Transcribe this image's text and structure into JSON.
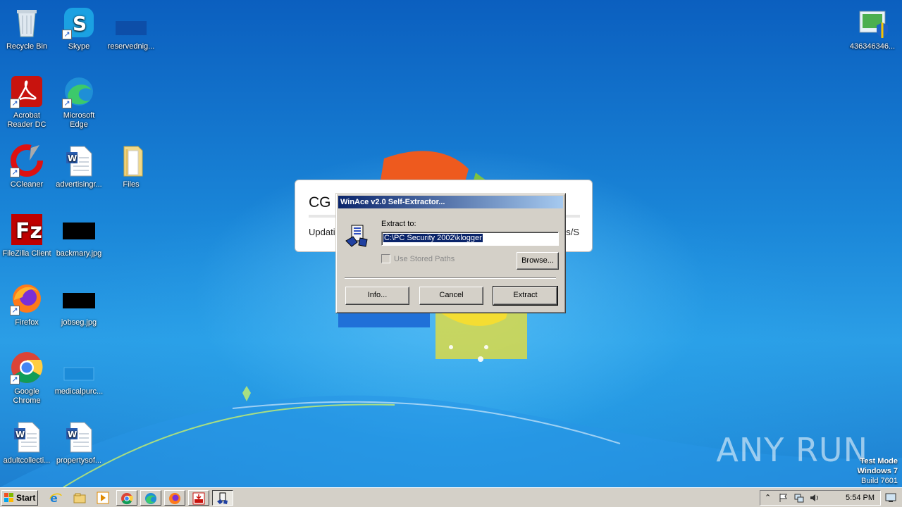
{
  "desktop": {
    "icons": [
      {
        "label": "Recycle Bin",
        "icon": "recycle-bin-icon"
      },
      {
        "label": "Skype",
        "icon": "skype-icon"
      },
      {
        "label": "reservednig...",
        "icon": "file-icon"
      },
      {
        "label": "Acrobat Reader DC",
        "icon": "acrobat-icon"
      },
      {
        "label": "Microsoft Edge",
        "icon": "edge-icon"
      },
      {
        "label": "CCleaner",
        "icon": "ccleaner-icon"
      },
      {
        "label": "advertisingr...",
        "icon": "word-doc-icon"
      },
      {
        "label": "Files",
        "icon": "folder-icon"
      },
      {
        "label": "FileZilla Client",
        "icon": "filezilla-icon"
      },
      {
        "label": "backmary.jpg",
        "icon": "image-file-icon"
      },
      {
        "label": "Firefox",
        "icon": "firefox-icon"
      },
      {
        "label": "jobseg.jpg",
        "icon": "image-file-icon"
      },
      {
        "label": "Google Chrome",
        "icon": "chrome-icon"
      },
      {
        "label": "medicalpurc...",
        "icon": "file-icon"
      },
      {
        "label": "adultcollecti...",
        "icon": "word-doc-icon"
      },
      {
        "label": "propertysof...",
        "icon": "word-doc-icon"
      },
      {
        "label": "436346346...",
        "icon": "installer-icon"
      }
    ]
  },
  "background_window": {
    "title": "CG U",
    "status": "Updatin",
    "status_right": "s/S"
  },
  "dialog": {
    "title": "WinAce v2.0 Self-Extractor...",
    "extract_label": "Extract to:",
    "extract_path": "C:\\PC Security 2002\\klogger",
    "stored_paths_label": "Use Stored Paths",
    "stored_paths_checked": false,
    "browse_label": "Browse...",
    "info_label": "Info...",
    "cancel_label": "Cancel",
    "extract_button_label": "Extract"
  },
  "watermark": {
    "brand": "ANY RUN",
    "mode": "Test Mode",
    "os": "Windows 7",
    "build": "Build 7601"
  },
  "taskbar": {
    "start_label": "Start",
    "clock": "5:54 PM",
    "quick_launch": [
      "ie-icon",
      "explorer-icon",
      "media-player-icon",
      "chrome-icon",
      "edge-icon",
      "firefox-icon",
      "acrobat-icon",
      "winace-icon"
    ],
    "tray_icons": [
      "show-hidden-icon",
      "flag-icon",
      "network-icon",
      "volume-icon"
    ]
  },
  "colors": {
    "desktop_blue": "#1580d4",
    "dialog_face": "#d4d0c8",
    "title_gradient_start": "#0a246a",
    "title_gradient_end": "#a6caf0"
  }
}
